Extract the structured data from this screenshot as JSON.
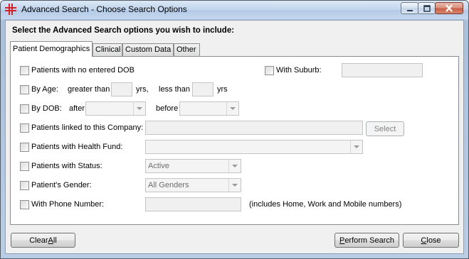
{
  "window": {
    "title": "Advanced Search - Choose Search Options"
  },
  "instruction": "Select the Advanced Search options you wish to include:",
  "tabs": [
    {
      "label": "Patient Demographics",
      "active": true
    },
    {
      "label": "Clinical",
      "active": false
    },
    {
      "label": "Custom Data",
      "active": false
    },
    {
      "label": "Other",
      "active": false
    }
  ],
  "options": {
    "no_dob": "Patients with no entered DOB",
    "suburb": "With Suburb:",
    "by_age": "By Age:",
    "greater_than": "greater than",
    "yrs1": "yrs,",
    "less_than": "less than",
    "yrs2": "yrs",
    "by_dob": "By DOB:",
    "after": "after",
    "before": "before",
    "company": "Patients linked to this Company:",
    "select_btn": "Select",
    "health_fund": "Patients with Health Fund:",
    "status": "Patients with Status:",
    "status_value": "Active",
    "gender": "Patient's Gender:",
    "gender_value": "All Genders",
    "phone": "With Phone Number:",
    "phone_note": "(includes Home, Work and Mobile numbers)"
  },
  "buttons": {
    "clear_all_pre": "Clear ",
    "clear_all_key": "A",
    "clear_all_post": "ll",
    "perform_key": "P",
    "perform_post": "erform Search",
    "close_key": "C",
    "close_post": "lose"
  },
  "colors": {
    "app_icon": "#d2232a"
  }
}
